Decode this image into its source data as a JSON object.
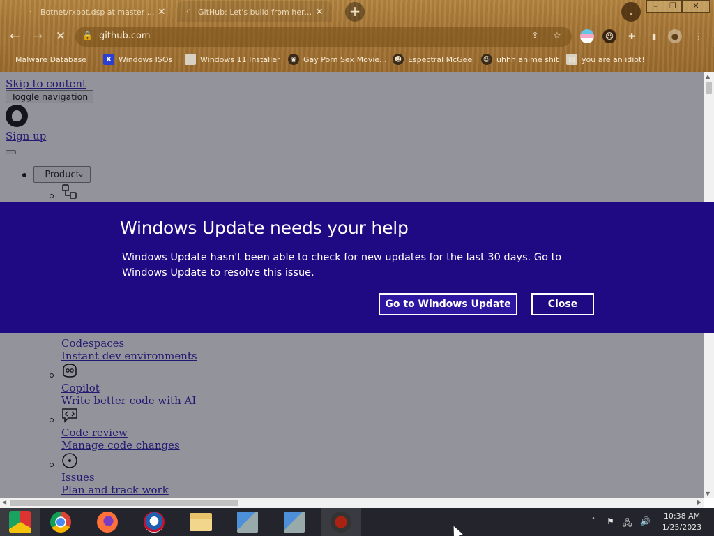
{
  "browser": {
    "tabs": [
      {
        "title": "Botnet/rxbot.dsp at master · mal",
        "close": "✕"
      },
      {
        "title": "GitHub: Let's build from here · G",
        "close": "✕"
      }
    ],
    "new_tab": "+",
    "url": "github.com",
    "bookmarks": [
      "Malware Database",
      "Windows ISOs",
      "Windows 11 Installer",
      "Gay Porn Sex Movie...",
      "Espectral McGee",
      "uhhh anime shit",
      "you are an idiot!"
    ]
  },
  "page": {
    "skip_link": "Skip to content",
    "toggle_nav": "Toggle navigation",
    "sign_up": "Sign up",
    "product_button": "Product",
    "menu_items": [
      {
        "title": "Codespaces",
        "desc": "Instant dev environments"
      },
      {
        "title": "Copilot",
        "desc": "Write better code with AI"
      },
      {
        "title": "Code review",
        "desc": "Manage code changes"
      },
      {
        "title": "Issues",
        "desc": "Plan and track work"
      }
    ]
  },
  "update_banner": {
    "title": "Windows Update needs your help",
    "message": "Windows Update hasn't been able to check for new updates for the last 30 days. Go to Windows Update to resolve this issue.",
    "primary_button": "Go to Windows Update",
    "close_button": "Close",
    "background_color": "#1f0a84"
  },
  "taskbar": {
    "time": "10:38 AM",
    "date": "1/25/2023"
  }
}
